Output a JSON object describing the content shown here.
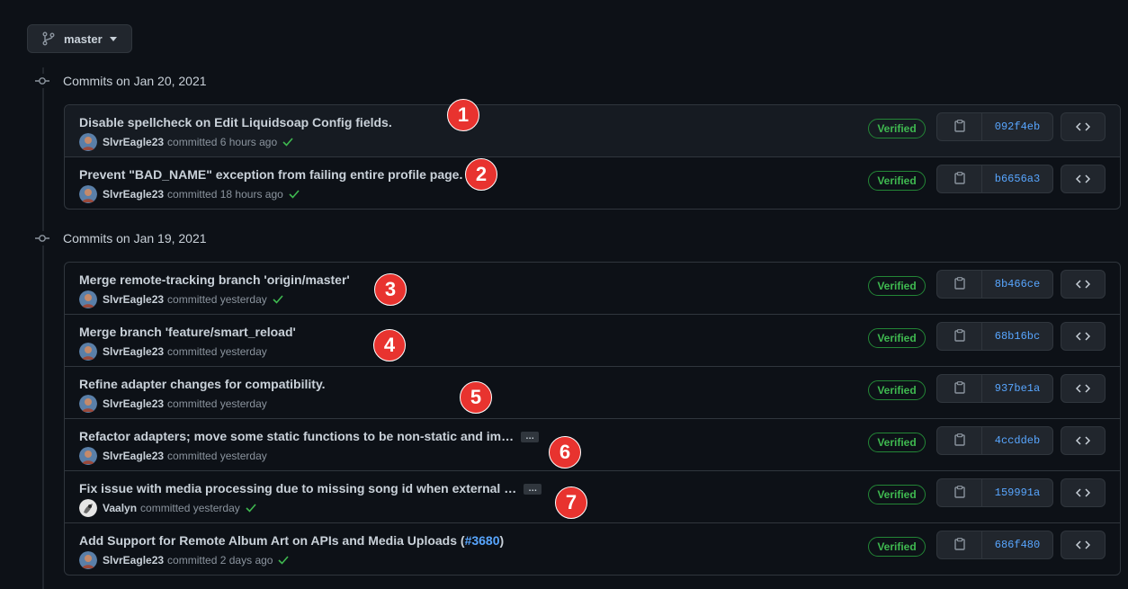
{
  "branch": {
    "name": "master"
  },
  "groups": [
    {
      "title": "Commits on Jan 20, 2021",
      "commits": [
        {
          "message": "Disable spellcheck on Edit Liquidsoap Config fields.",
          "author": "SlvrEagle23",
          "action": "committed",
          "time": "6 hours ago",
          "check": true,
          "verified": "Verified",
          "sha": "092f4eb",
          "ellipsis": false
        },
        {
          "message": "Prevent \"BAD_NAME\" exception from failing entire profile page.",
          "author": "SlvrEagle23",
          "action": "committed",
          "time": "18 hours ago",
          "check": true,
          "verified": "Verified",
          "sha": "b6656a3",
          "ellipsis": false
        }
      ]
    },
    {
      "title": "Commits on Jan 19, 2021",
      "commits": [
        {
          "message": "Merge remote-tracking branch 'origin/master'",
          "author": "SlvrEagle23",
          "action": "committed",
          "time": "yesterday",
          "check": true,
          "verified": "Verified",
          "sha": "8b466ce",
          "ellipsis": false
        },
        {
          "message": "Merge branch 'feature/smart_reload'",
          "author": "SlvrEagle23",
          "action": "committed",
          "time": "yesterday",
          "check": false,
          "verified": "Verified",
          "sha": "68b16bc",
          "ellipsis": false
        },
        {
          "message": "Refine adapter changes for compatibility.",
          "author": "SlvrEagle23",
          "action": "committed",
          "time": "yesterday",
          "check": false,
          "verified": "Verified",
          "sha": "937be1a",
          "ellipsis": false
        },
        {
          "message": "Refactor adapters; move some static functions to be non-static and im…",
          "author": "SlvrEagle23",
          "action": "committed",
          "time": "yesterday",
          "check": false,
          "verified": "Verified",
          "sha": "4ccddeb",
          "ellipsis": true
        },
        {
          "message": "Fix issue with media processing due to missing song id when external …",
          "author": "Vaalyn",
          "action": "committed",
          "time": "yesterday",
          "check": true,
          "verified": "Verified",
          "sha": "159991a",
          "ellipsis": true
        },
        {
          "message": "Add Support for Remote Album Art on APIs and Media Uploads (",
          "link": "#3680",
          "message_suffix": ")",
          "author": "SlvrEagle23",
          "action": "committed",
          "time": "2 days ago",
          "check": true,
          "verified": "Verified",
          "sha": "686f480",
          "ellipsis": false
        }
      ]
    }
  ],
  "ellipsis_label": "…",
  "markers": [
    "1",
    "2",
    "3",
    "4",
    "5",
    "6",
    "7"
  ],
  "colors": {
    "background": "#0d1117",
    "border": "#30363d",
    "link": "#58a6ff",
    "verified": "#3fb950",
    "marker": "#e8332f"
  }
}
